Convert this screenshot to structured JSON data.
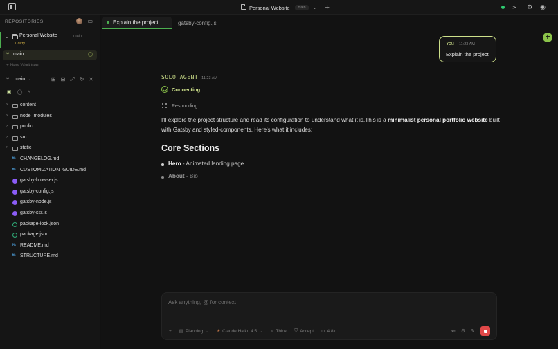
{
  "titlebar": {
    "project": "Personal Website",
    "branch": "main",
    "chevron": "⌄",
    "plus": "+",
    "terminal_glyph": ">_",
    "gear_glyph": "⚙",
    "user_glyph": "◉"
  },
  "sidebar": {
    "header": "REPOSITORIES",
    "repo": {
      "name": "Personal Website",
      "branch": "main",
      "status": "1 dirty",
      "chevron": "⌄"
    },
    "worktree": {
      "glyph": "⑂",
      "name": "main"
    },
    "new_worktree": "+ New Worktree",
    "branch_bar": {
      "glyph": "⑂",
      "name": "main",
      "chevron": "⌄",
      "tools": [
        "⊞",
        "⊟",
        "⤢",
        "↻",
        "✕"
      ]
    },
    "tab_icons": [
      "▣",
      "◯",
      "⑂"
    ],
    "tree": [
      {
        "name": "content",
        "kind": "folder",
        "chev": "›"
      },
      {
        "name": "node_modules",
        "kind": "folder",
        "chev": "›"
      },
      {
        "name": "public",
        "kind": "folder",
        "chev": "›"
      },
      {
        "name": "src",
        "kind": "folder",
        "chev": "›"
      },
      {
        "name": "static",
        "kind": "folder",
        "chev": "›"
      },
      {
        "name": "CHANGELOG.md",
        "kind": "md",
        "chev": ""
      },
      {
        "name": "CUSTOMIZATION_GUIDE.md",
        "kind": "md",
        "chev": ""
      },
      {
        "name": "gatsby-browser.js",
        "kind": "js",
        "chev": ""
      },
      {
        "name": "gatsby-config.js",
        "kind": "js",
        "chev": ""
      },
      {
        "name": "gatsby-node.js",
        "kind": "js",
        "chev": ""
      },
      {
        "name": "gatsby-ssr.js",
        "kind": "js",
        "chev": ""
      },
      {
        "name": "package-lock.json",
        "kind": "json",
        "chev": ""
      },
      {
        "name": "package.json",
        "kind": "json",
        "chev": ""
      },
      {
        "name": "README.md",
        "kind": "md",
        "chev": ""
      },
      {
        "name": "STRUCTURE.md",
        "kind": "md",
        "chev": ""
      }
    ]
  },
  "tabs": {
    "active": "Explain the project",
    "inactive": "gatsby-config.js"
  },
  "user_message": {
    "who": "You",
    "time": "11:23 AM",
    "text": "Explain the project"
  },
  "agent": {
    "name": "SOLO AGENT",
    "time": "11:23 AM",
    "connecting": "Connecting",
    "responding": "Responding...",
    "para_1": "I'll explore the project structure and read its configuration to understand what it is.This is a ",
    "para_bold_1": "minimalist personal portfolio website",
    "para_2": " built with Gatsby and styled-components. Here's what it includes:",
    "heading": "Core Sections",
    "bullets": [
      {
        "title": "Hero",
        "desc": " - Animated landing page"
      },
      {
        "title": "About",
        "desc": " - Bio"
      }
    ]
  },
  "composer": {
    "placeholder": "Ask anything, @ for context",
    "plus": "+",
    "mode": "Planning",
    "model": "Claude Haiku 4.5",
    "think": "Think",
    "accept": "Accept",
    "tokens": "4.8k",
    "right_glyphs": [
      "⇐",
      "⚙",
      "✎"
    ]
  },
  "colors": {
    "accent": "#8bc34a",
    "stop": "#e04848",
    "agent": "#cde08a"
  }
}
